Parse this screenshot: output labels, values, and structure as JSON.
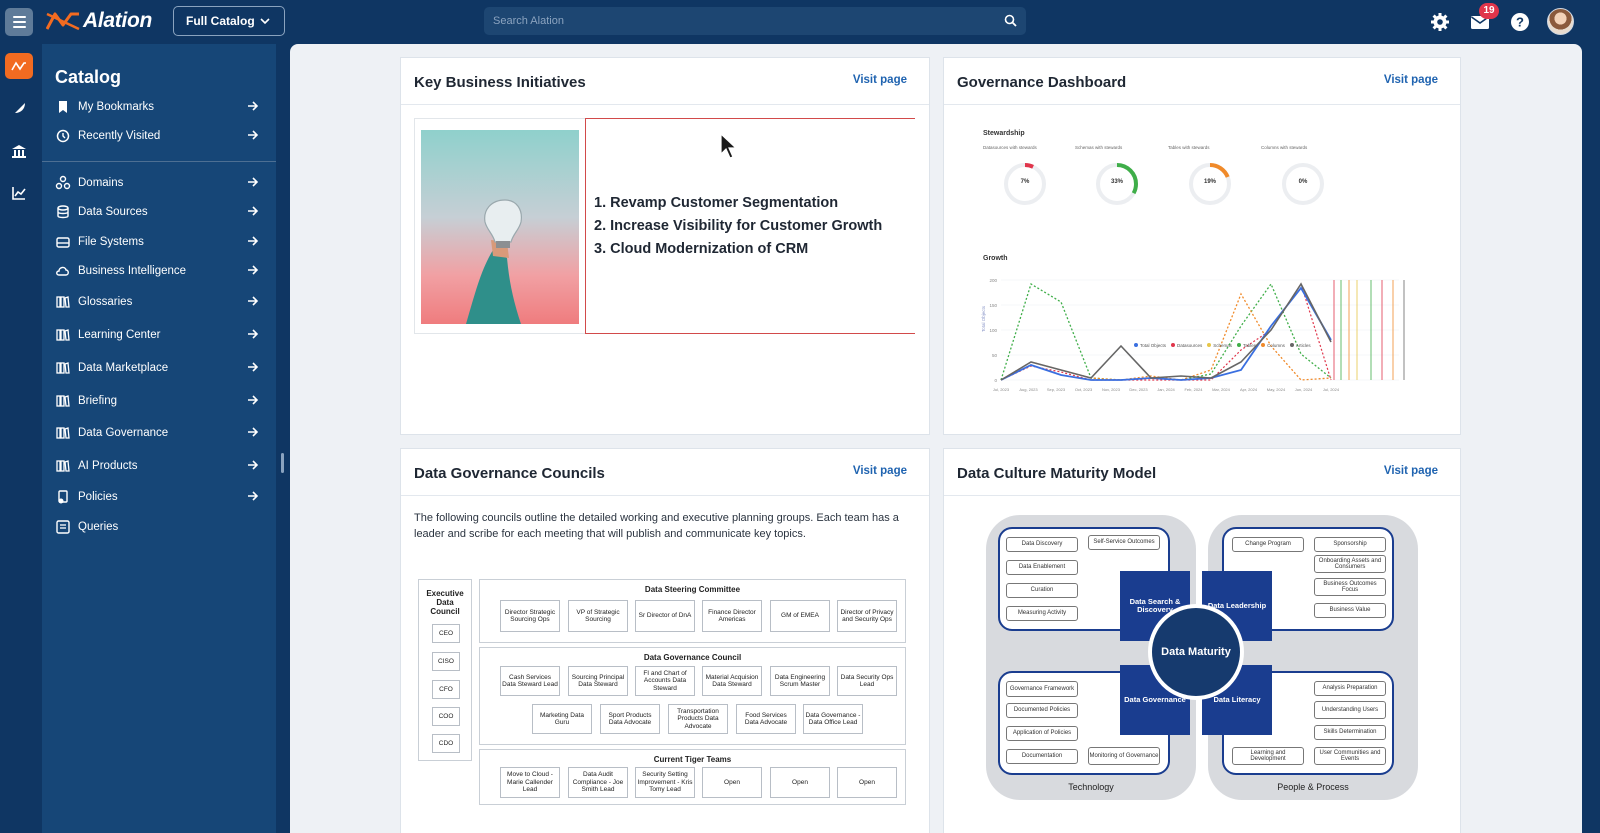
{
  "header": {
    "brand": "Alation",
    "catalog_selector": "Full Catalog",
    "search_placeholder": "Search Alation",
    "notification_count": "19"
  },
  "sidebar": {
    "title": "Catalog",
    "items": [
      {
        "label": "My Bookmarks",
        "icon": "bookmark-icon"
      },
      {
        "label": "Recently Visited",
        "icon": "history-icon"
      },
      {
        "label": "Domains",
        "icon": "domains-icon"
      },
      {
        "label": "Data Sources",
        "icon": "database-icon"
      },
      {
        "label": "File Systems",
        "icon": "drive-icon"
      },
      {
        "label": "Business Intelligence",
        "icon": "cloud-icon"
      },
      {
        "label": "Glossaries",
        "icon": "book-icon"
      },
      {
        "label": "Learning Center",
        "icon": "book-icon"
      },
      {
        "label": "Data Marketplace",
        "icon": "book-icon"
      },
      {
        "label": "Briefing",
        "icon": "book-icon"
      },
      {
        "label": "Data Governance",
        "icon": "book-icon"
      },
      {
        "label": "AI Products",
        "icon": "book-icon"
      },
      {
        "label": "Policies",
        "icon": "policy-icon"
      },
      {
        "label": "Queries",
        "icon": "query-icon"
      }
    ]
  },
  "cards": {
    "initiatives": {
      "title": "Key Business Initiatives",
      "visit": "Visit page",
      "items": [
        "1. Revamp Customer Segmentation",
        "2. Increase Visibility for Customer Growth",
        "3. Cloud Modernization of CRM"
      ]
    },
    "dashboard": {
      "title": "Governance Dashboard",
      "visit": "Visit page",
      "stewardship_label": "Stewardship",
      "growth_label": "Growth",
      "gauges": [
        {
          "label": "Datasources with stewards",
          "value": "7%",
          "fraction": 0.07,
          "color": "#e0354b"
        },
        {
          "label": "Schemas with stewards",
          "value": "33%",
          "fraction": 0.33,
          "color": "#3fae49"
        },
        {
          "label": "Tables with stewards",
          "value": "19%",
          "fraction": 0.19,
          "color": "#f08a2a"
        },
        {
          "label": "Columns with stewards",
          "value": "0%",
          "fraction": 0.0,
          "color": "#9aa3ad"
        }
      ],
      "growth_x_labels": [
        "Jul, 2023",
        "Aug, 2023",
        "Sep, 2023",
        "Oct, 2023",
        "Nov, 2023",
        "Dec, 2023",
        "Jan, 2024",
        "Feb, 2024",
        "Mar, 2024",
        "Apr, 2024",
        "May, 2024",
        "Jun, 2024",
        "Jul, 2024"
      ],
      "growth_y_labels": [
        "0",
        "50",
        "100",
        "150",
        "200"
      ],
      "growth_y_title": "Total Objects",
      "legend": [
        "Total Objects",
        "Datasources",
        "Schemas",
        "Tables",
        "Columns",
        "Articles"
      ]
    },
    "councils": {
      "title": "Data Governance Councils",
      "visit": "Visit page",
      "description": "The following councils outline the detailed working and executive planning groups. Each team has a leader and scribe for each meeting that will publish and communicate key topics.",
      "executive_title": "Executive Data Council",
      "executive_members": [
        "CEO",
        "CISO",
        "CFO",
        "COO",
        "CDO"
      ],
      "steering_title": "Data Steering Committee",
      "steering_members": [
        "Director Strategic Sourcing Ops",
        "VP of Strategic Sourcing",
        "Sr Director of DnA",
        "Finance Director Americas",
        "GM of EMEA",
        "Director of Privacy and Security Ops"
      ],
      "council_title": "Data Governance Council",
      "council_row1": [
        "Cash Services Data Steward Lead",
        "Sourcing Principal Data Steward",
        "FI and Chart of Accounts Data Steward",
        "Material Acquision Data Steward",
        "Data Engineering Scrum Master",
        "Data Security Ops Lead"
      ],
      "council_row2": [
        "Marketing Data Guru",
        "Sport Products Data Advocate",
        "Transportation Products Data Advocate",
        "Food Services Data Advocate",
        "Data Governance - Data Office Lead"
      ],
      "tiger_title": "Current Tiger Teams",
      "tiger_members": [
        "Move to Cloud - Marie Callender Lead",
        "Data Audit Compliance - Joe Smith Lead",
        "Security Setting Improvement - Kris Tomy Lead",
        "Open",
        "Open",
        "Open"
      ]
    },
    "maturity": {
      "title": "Data Culture Maturity Model",
      "visit": "Visit page",
      "center": "Data Maturity",
      "corners": [
        "Data Search & Discovery",
        "Data Leadership",
        "Data Governance",
        "Data Literacy"
      ],
      "technology_caption": "Technology",
      "people_caption": "People & Process",
      "tl_boxes": [
        "Data Discovery",
        "Self-Service Outcomes",
        "Data Enablement",
        "Curation",
        "Measuring Activity"
      ],
      "tr_boxes": [
        "Change Program",
        "Sponsorship",
        "Onboarding Assets and Consumers",
        "Business Outcomes Focus",
        "Business Value"
      ],
      "bl_boxes": [
        "Governance Framework",
        "Documented Policies",
        "Application of Policies",
        "Documentation",
        "Monitoring of Governance"
      ],
      "br_boxes": [
        "Analysis Preparation",
        "Understanding Users",
        "Skills Determination",
        "Learning and Development",
        "User Communities and Events"
      ]
    }
  },
  "colors": {
    "nav_bg": "#0f3663",
    "sidebar_bg": "#164677",
    "accent": "#f26b21",
    "link": "#1f63b0",
    "maturity_blue": "#1a3d8f"
  }
}
